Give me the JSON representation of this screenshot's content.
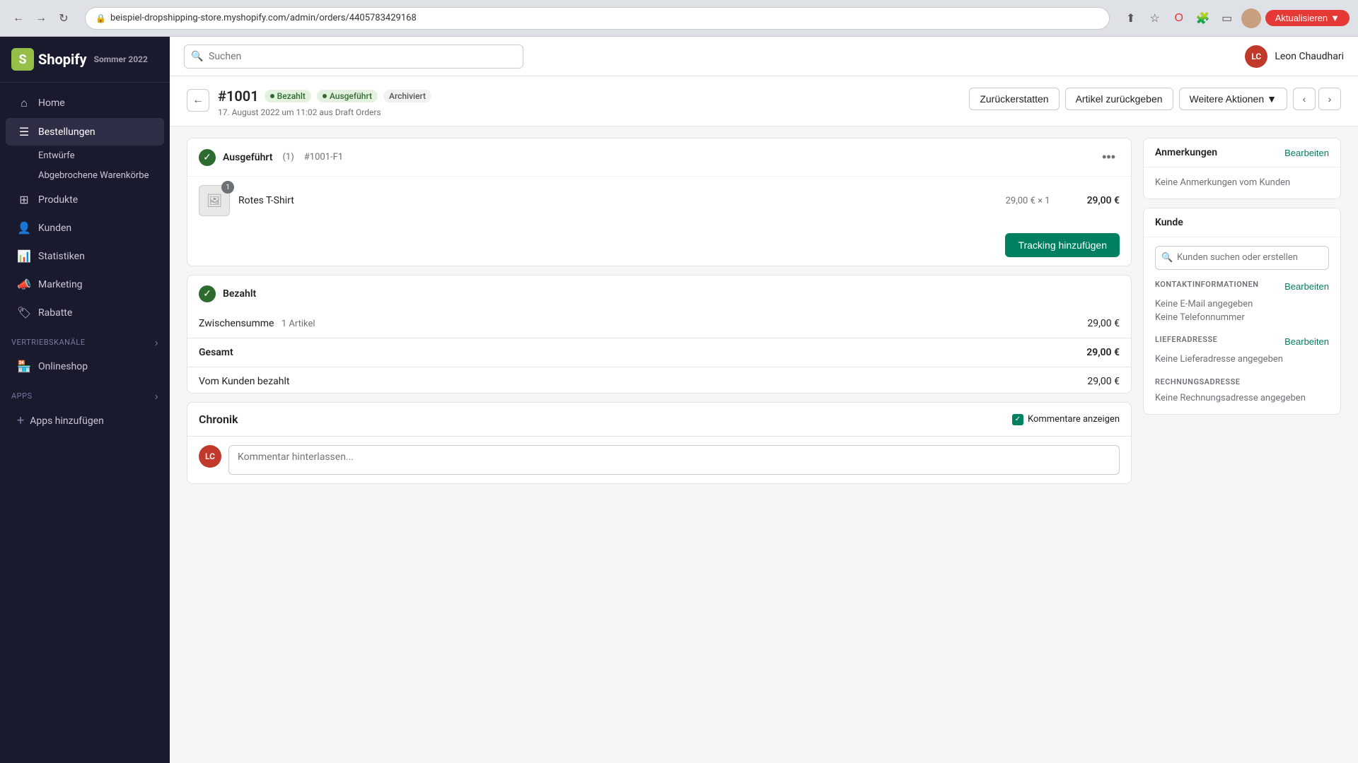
{
  "browser": {
    "url": "beispiel-dropshipping-store.myshopify.com/admin/orders/4405783429168",
    "aktualisieren": "Aktualisieren"
  },
  "topbar": {
    "search_placeholder": "Suchen",
    "logo": "Shopify",
    "subtitle": "Sommer 2022",
    "user_name": "Leon Chaudhari",
    "user_initials": "LC"
  },
  "sidebar": {
    "items": [
      {
        "id": "home",
        "label": "Home",
        "icon": "⌂"
      },
      {
        "id": "bestellungen",
        "label": "Bestellungen",
        "icon": "☰",
        "active": true
      },
      {
        "id": "entwurfe",
        "label": "Entwürfe",
        "sub": true
      },
      {
        "id": "abgebrochene",
        "label": "Abgebrochene Warenkörbe",
        "sub": true
      },
      {
        "id": "produkte",
        "label": "Produkte",
        "icon": "⊞"
      },
      {
        "id": "kunden",
        "label": "Kunden",
        "icon": "👤"
      },
      {
        "id": "statistiken",
        "label": "Statistiken",
        "icon": "📊"
      },
      {
        "id": "marketing",
        "label": "Marketing",
        "icon": "📣"
      },
      {
        "id": "rabatte",
        "label": "Rabatte",
        "icon": "🏷"
      }
    ],
    "vertriebskanaele_label": "Vertriebskanäle",
    "onlineshop": "Onlineshop",
    "apps_label": "Apps",
    "apps_hinzufuegen": "Apps hinzufügen"
  },
  "page": {
    "order_number": "#1001",
    "badge_paid": "Bezahlt",
    "badge_fulfilled": "Ausgeführt",
    "badge_archived": "Archiviert",
    "order_date": "17. August 2022 um 11:02 aus Draft Orders",
    "btn_zurueckerstatten": "Zurückerstatten",
    "btn_artikel_zurueckgeben": "Artikel zurückgeben",
    "btn_weitere_aktionen": "Weitere Aktionen"
  },
  "fulfillment_card": {
    "title": "Ausgeführt",
    "count": "(1)",
    "order_id": "#1001-F1",
    "product_name": "Rotes T-Shirt",
    "product_price": "29,00 € × 1",
    "product_total": "29,00 €",
    "product_qty": "1",
    "tracking_btn": "Tracking hinzufügen"
  },
  "payment_card": {
    "title": "Bezahlt",
    "zwischensumme_label": "Zwischensumme",
    "zwischensumme_sub": "1 Artikel",
    "zwischensumme_val": "29,00 €",
    "gesamt_label": "Gesamt",
    "gesamt_val": "29,00 €",
    "vom_kunden_label": "Vom Kunden bezahlt",
    "vom_kunden_val": "29,00 €"
  },
  "chronik": {
    "title": "Chronik",
    "kommentare_anzeigen": "Kommentare anzeigen",
    "comment_placeholder": "Kommentar hinterlassen...",
    "user_initials": "LC"
  },
  "right_panel": {
    "anmerkungen": {
      "title": "Anmerkungen",
      "edit_label": "Bearbeiten",
      "text": "Keine Anmerkungen vom Kunden"
    },
    "kunde": {
      "title": "Kunde",
      "search_placeholder": "Kunden suchen oder erstellen"
    },
    "kontaktinfos": {
      "section_label": "KONTAKTINFORMATIONEN",
      "edit_label": "Bearbeiten",
      "email": "Keine E-Mail angegeben",
      "telefon": "Keine Telefonnummer"
    },
    "lieferadresse": {
      "section_label": "LIEFERADRESSE",
      "edit_label": "Bearbeiten",
      "text": "Keine Lieferadresse angegeben"
    },
    "rechnungsadresse": {
      "section_label": "RECHNUNGSADRESSE",
      "text": "Keine Rechnungsadresse angegeben"
    }
  }
}
